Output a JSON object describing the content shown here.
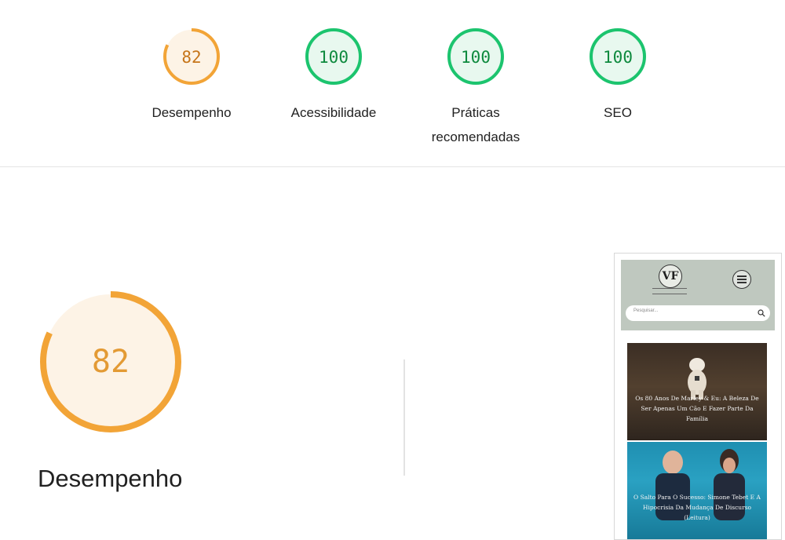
{
  "summary": {
    "gauges": [
      {
        "score": "82",
        "label": "Desempenho",
        "status": "average"
      },
      {
        "score": "100",
        "label": "Acessibilidade",
        "status": "pass"
      },
      {
        "score": "100",
        "label": "Práticas recomendadas",
        "status": "pass"
      },
      {
        "score": "100",
        "label": "SEO",
        "status": "pass"
      }
    ]
  },
  "performance": {
    "score": "82",
    "score_fraction": 0.82,
    "label": "Desempenho"
  },
  "colors": {
    "average_stroke": "#f2a437",
    "average_text": "#c6751a",
    "average_fill": "#fdf3e6",
    "pass_stroke": "#1cc46e",
    "pass_text": "#0e8a3e",
    "pass_fill": "#e8f8ef"
  },
  "preview": {
    "logo_text": "VF",
    "search_placeholder": "Pesquisar...",
    "posts": [
      {
        "title": "Os 80 Anos De Marley & Eu: A Beleza De Ser Apenas Um Cão E Fazer Parte Da Família"
      },
      {
        "title": "O Salto Para O Sucesso: Simone Tebet E A Hipocrisia Da Mudança De Discurso (Leitura)"
      }
    ]
  }
}
